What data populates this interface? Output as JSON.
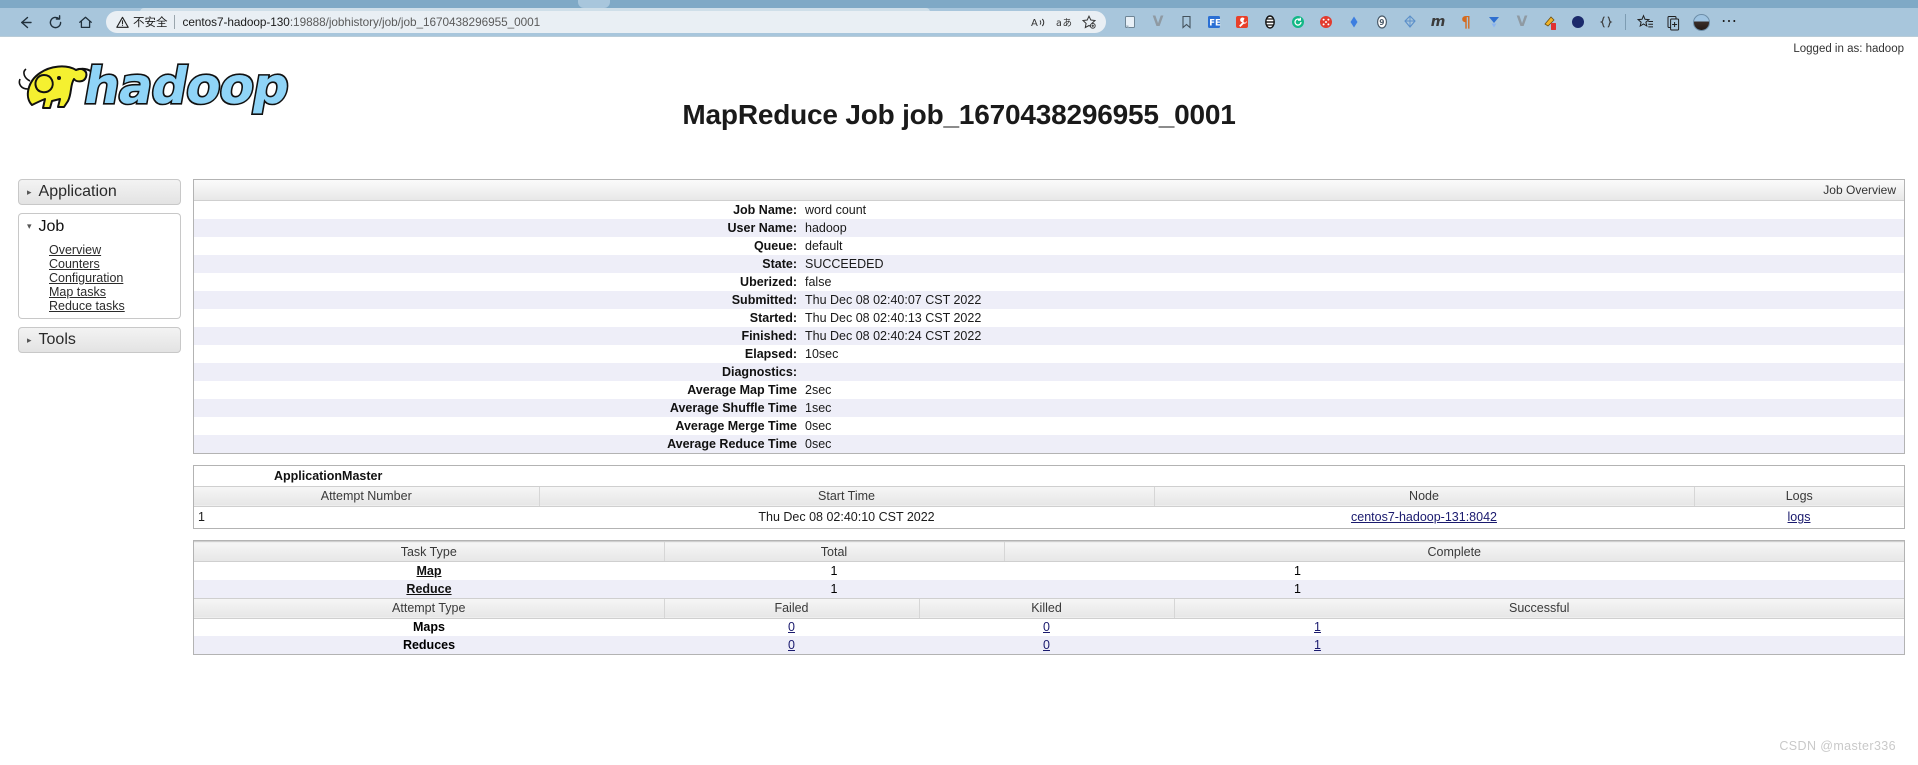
{
  "browser": {
    "nav": {
      "back": "back-arrow",
      "reload": "reload",
      "home": "home"
    },
    "address": {
      "warning_label": "不安全",
      "url_host": "centos7-hadoop-130",
      "url_rest": ":19888/jobhistory/job/job_1670438296955_0001",
      "full_url": "centos7-hadoop-130:19888/jobhistory/job/job_1670438296955_0001",
      "read_aloud_icon": "A-with-sound-waves",
      "translate_icon": "translate-a-character",
      "favorite_icon": "star-add"
    },
    "extensions": [
      {
        "name": "extension-notes",
        "glyph": "❐",
        "color": "#d6e6f2"
      },
      {
        "name": "extension-v-gray",
        "glyph": "V",
        "color": "#8f9aa3"
      },
      {
        "name": "extension-bookmark",
        "glyph": "▯",
        "color": "#44525c"
      },
      {
        "name": "extension-feedly",
        "glyph": "FE",
        "color": "#2a6fd4"
      },
      {
        "name": "extension-wrench-red",
        "glyph": "⚒",
        "color": "#e8402a"
      },
      {
        "name": "extension-capsule",
        "glyph": "●",
        "color": "#ffffff"
      },
      {
        "name": "extension-refresh-green",
        "glyph": "↻",
        "color": "#12b886"
      },
      {
        "name": "extension-dice-red",
        "glyph": "⚄",
        "color": "#e23b2e"
      },
      {
        "name": "extension-diamond-blue",
        "glyph": "♦",
        "color": "#3d7ee0"
      },
      {
        "name": "extension-oval-gray",
        "glyph": "○",
        "color": "#5a6b7a"
      },
      {
        "name": "extension-kite",
        "glyph": "⧖",
        "color": "#5b8fc9"
      },
      {
        "name": "extension-m-letter",
        "glyph": "m",
        "color": "#3b3b3b"
      },
      {
        "name": "extension-pilcrow",
        "glyph": "¶",
        "color": "#d46a1e"
      },
      {
        "name": "extension-triangle-blue",
        "glyph": "▼",
        "color": "#2f6fd0"
      },
      {
        "name": "extension-v-gray-2",
        "glyph": "V",
        "color": "#8f9aa3"
      },
      {
        "name": "extension-paint-red",
        "glyph": "✎",
        "color": "#e03131"
      },
      {
        "name": "extension-circle-orange",
        "glyph": "◖",
        "color": "#f08c00"
      },
      {
        "name": "extension-braces",
        "glyph": "{}",
        "color": "#3b3b3b"
      }
    ],
    "right_icons": [
      {
        "name": "favorites-icon",
        "glyph": "☆"
      },
      {
        "name": "collections-icon",
        "glyph": "⧉"
      }
    ],
    "profile": "avatar",
    "more": "⋯"
  },
  "page": {
    "logged_in_as": "Logged in as: hadoop",
    "title": "MapReduce Job job_1670438296955_0001",
    "watermark": "CSDN @master336",
    "logo_alt": "hadoop"
  },
  "sidebar": {
    "groups": [
      {
        "name": "Application",
        "label": "Application",
        "expanded": false,
        "arrow": "▸",
        "items": []
      },
      {
        "name": "Job",
        "label": "Job",
        "expanded": true,
        "arrow": "▾",
        "items": [
          {
            "label": "Overview",
            "name": "sidebar-link-overview"
          },
          {
            "label": "Counters",
            "name": "sidebar-link-counters"
          },
          {
            "label": "Configuration",
            "name": "sidebar-link-configuration"
          },
          {
            "label": "Map tasks",
            "name": "sidebar-link-map-tasks"
          },
          {
            "label": "Reduce tasks",
            "name": "sidebar-link-reduce-tasks"
          }
        ]
      },
      {
        "name": "Tools",
        "label": "Tools",
        "expanded": false,
        "arrow": "▸",
        "items": []
      }
    ]
  },
  "job_overview": {
    "panel_label": "Job Overview",
    "rows": [
      {
        "key": "Job Name:",
        "value": "word count"
      },
      {
        "key": "User Name:",
        "value": "hadoop"
      },
      {
        "key": "Queue:",
        "value": "default"
      },
      {
        "key": "State:",
        "value": "SUCCEEDED"
      },
      {
        "key": "Uberized:",
        "value": "false"
      },
      {
        "key": "Submitted:",
        "value": "Thu Dec 08 02:40:07 CST 2022"
      },
      {
        "key": "Started:",
        "value": "Thu Dec 08 02:40:13 CST 2022"
      },
      {
        "key": "Finished:",
        "value": "Thu Dec 08 02:40:24 CST 2022"
      },
      {
        "key": "Elapsed:",
        "value": "10sec"
      },
      {
        "key": "Diagnostics:",
        "value": ""
      },
      {
        "key": "Average Map Time",
        "value": "2sec"
      },
      {
        "key": "Average Shuffle Time",
        "value": "1sec"
      },
      {
        "key": "Average Merge Time",
        "value": "0sec"
      },
      {
        "key": "Average Reduce Time",
        "value": "0sec"
      }
    ]
  },
  "application_master": {
    "title": "ApplicationMaster",
    "headers": [
      "Attempt Number",
      "Start Time",
      "Node",
      "Logs"
    ],
    "rows": [
      {
        "attempt_number": "1",
        "start_time": "Thu Dec 08 02:40:10 CST 2022",
        "node": "centos7-hadoop-131:8042",
        "logs": "logs"
      }
    ]
  },
  "task_summary": {
    "headers": [
      "Task Type",
      "Total",
      "Complete"
    ],
    "rows": [
      {
        "task_type": "Map",
        "total": "1",
        "complete": "1"
      },
      {
        "task_type": "Reduce",
        "total": "1",
        "complete": "1"
      }
    ]
  },
  "attempt_summary": {
    "headers": [
      "Attempt Type",
      "Failed",
      "Killed",
      "Successful"
    ],
    "rows": [
      {
        "attempt_type": "Maps",
        "failed": "0",
        "killed": "0",
        "successful": "1"
      },
      {
        "attempt_type": "Reduces",
        "failed": "0",
        "killed": "0",
        "successful": "1"
      }
    ]
  }
}
